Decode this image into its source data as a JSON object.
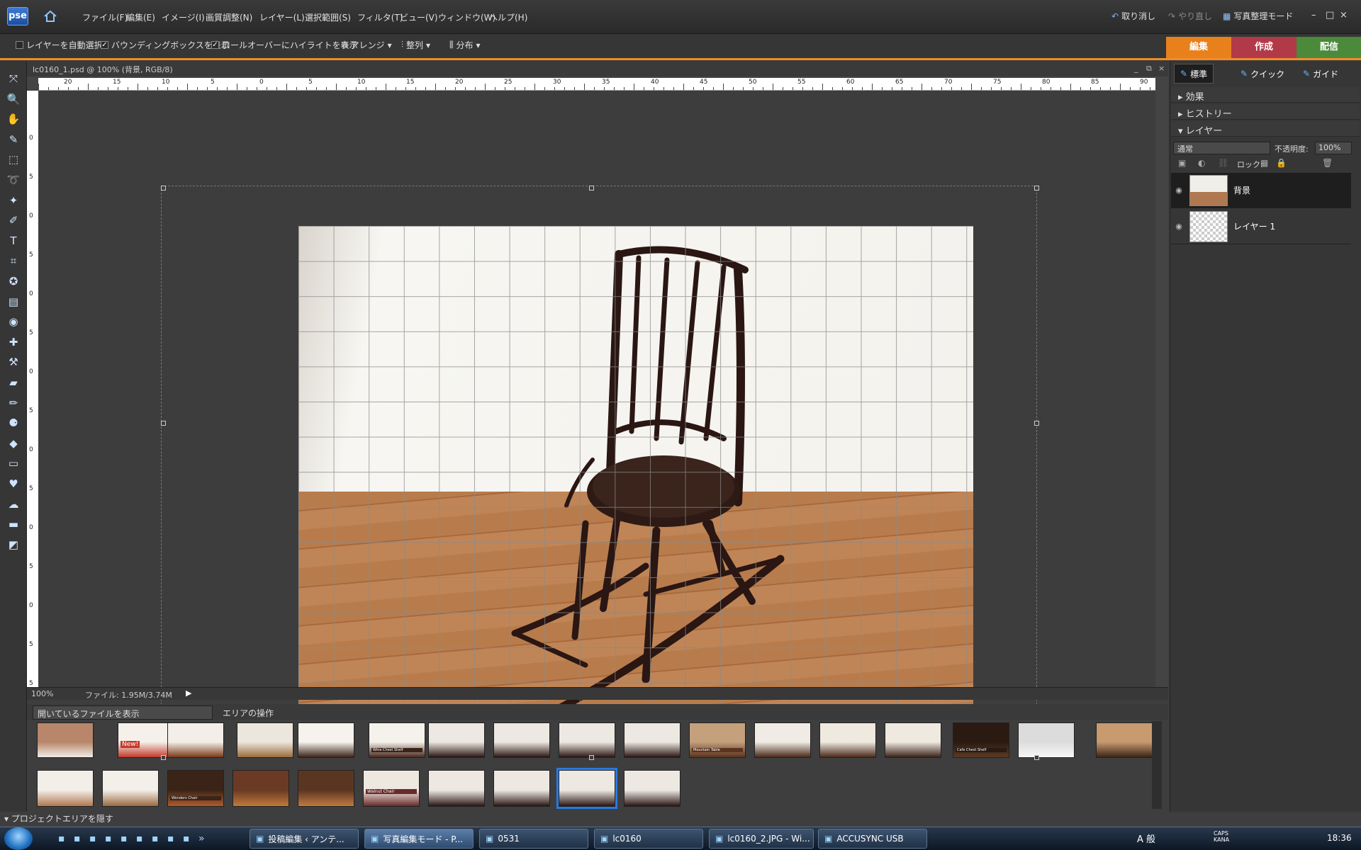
{
  "app": {
    "logo": "pse",
    "home_icon": "home-icon"
  },
  "menu": [
    "ファイル(F)",
    "編集(E)",
    "イメージ(I)",
    "画質調整(N)",
    "レイヤー(L)",
    "選択範囲(S)",
    "フィルタ(T)",
    "ビュー(V)",
    "ウィンドウ(W)",
    "ヘルプ(H)"
  ],
  "topright": {
    "undo": "取り消し",
    "redo": "やり直し",
    "organizer": "写真整理モード",
    "min": "–",
    "max": "□",
    "close": "×"
  },
  "options": {
    "auto_select": "レイヤーを自動選択",
    "bbox": "バウンディングボックスを表示",
    "rollover": "ロールオーバーにハイライトを表示",
    "arrange": "アレンジ",
    "align": "整列",
    "distribute": "分布",
    "bbox_checked": true,
    "rollover_checked": true,
    "auto_checked": false
  },
  "mode_tabs": [
    {
      "label": "編集",
      "color": "#e8801c"
    },
    {
      "label": "作成",
      "color": "#b23a48"
    },
    {
      "label": "配信",
      "color": "#4a8a3a"
    }
  ],
  "doc": {
    "title": "lc0160_1.psd @ 100% (背景, RGB/8)",
    "zoom": "100%",
    "file_info": "ファイル: 1.95M/3.74M"
  },
  "ruler_top": [
    "20",
    "15",
    "10",
    "5",
    "0",
    "5",
    "10",
    "15",
    "20",
    "25",
    "30",
    "35",
    "40",
    "45",
    "50",
    "55",
    "60",
    "65",
    "70",
    "75",
    "80",
    "85",
    "90"
  ],
  "ruler_left": [
    "0",
    "5",
    "0",
    "5",
    "0",
    "5",
    "0",
    "5",
    "0",
    "5",
    "0",
    "5",
    "0",
    "5",
    "5"
  ],
  "project": {
    "dropdown": "開いているファイルを表示",
    "area_ops": "エリアの操作",
    "toggle": "プロジェクトエリアを隠す"
  },
  "thumb_labels": {
    "new": "New!",
    "book": "Wine Chest Shelf",
    "chairs": "Mountain Table",
    "dark": "Cafe Chest Shelf",
    "pub": "Wonders Chair",
    "card": "Walnut Chair"
  },
  "right_tabs": [
    {
      "label": "標準",
      "icon": "brush-icon"
    },
    {
      "label": "クイック",
      "icon": "wand-icon"
    },
    {
      "label": "ガイド",
      "icon": "guide-icon"
    }
  ],
  "panels": {
    "effects": "効果",
    "history": "ヒストリー",
    "layers": "レイヤー"
  },
  "layers_panel": {
    "blend": "通常",
    "opacity_label": "不透明度:",
    "opacity": "100%",
    "lock": "ロック:"
  },
  "layers": [
    {
      "name": "背景",
      "selected": true
    },
    {
      "name": "レイヤー 1",
      "selected": false
    }
  ],
  "taskbar": {
    "tasks": [
      "投稿編集 ‹ アンテ...",
      "写真編集モード - P...",
      "0531",
      "lc0160",
      "lc0160_2.JPG - Wi...",
      "ACCUSYNC USB"
    ],
    "clock": "18:36",
    "ime": "A 般",
    "caps": "CAPS KANA"
  }
}
